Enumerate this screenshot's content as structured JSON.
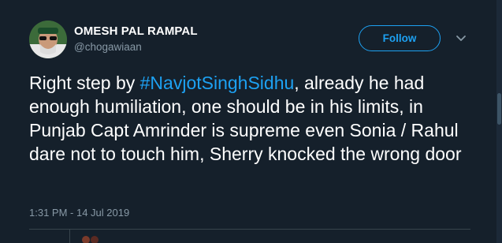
{
  "user": {
    "display_name": "OMESH PAL RAMPAL",
    "handle": "@chogawiaan"
  },
  "follow_label": "Follow",
  "tweet": {
    "text_before": "Right step by ",
    "hashtag": "#NavjotSinghSidhu",
    "text_after": ", already he had enough humiliation, one should be in his limits,  in Punjab Capt Amrinder is supreme even Sonia / Rahul dare not to touch him, Sherry knocked the wrong door",
    "timestamp": "1:31 PM - 14 Jul 2019"
  },
  "icons": [
    "avatar",
    "chevron-down-icon"
  ],
  "colors": {
    "background": "#15202b",
    "accent": "#1da1f2",
    "secondary_text": "#8899a6",
    "primary_text": "#ffffff"
  }
}
